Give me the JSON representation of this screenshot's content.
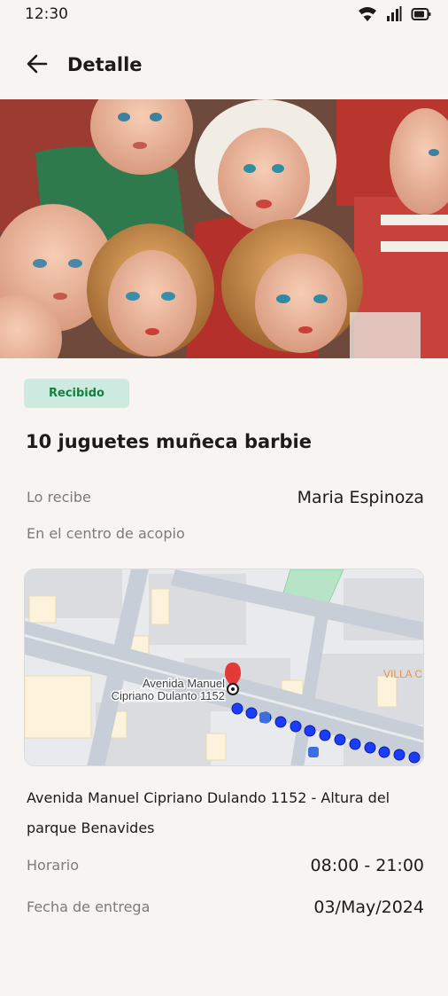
{
  "status_bar": {
    "time": "12:30",
    "icons": [
      "wifi-icon",
      "signal-icon",
      "battery-icon"
    ]
  },
  "app_bar": {
    "title": "Detalle",
    "back_icon": "arrow-left-icon"
  },
  "hero_image": {
    "subject": "vintage dolls"
  },
  "item": {
    "status_badge": "Recibido",
    "title": "10 juguetes muñeca barbie"
  },
  "details": {
    "receiver_label": "Lo recibe",
    "receiver_value": "Maria Espinoza",
    "location_note": "En el centro de acopio",
    "schedule_label": "Horario",
    "schedule_value": "08:00 - 21:00",
    "delivery_date_label": "Fecha de entrega",
    "delivery_date_value": "03/May/2024"
  },
  "map": {
    "pin_label_line1": "Avenida Manuel",
    "pin_label_line2": "Cipriano Dulanto 1152",
    "area_label": "VILLA C"
  },
  "address": {
    "text": "Avenida Manuel Cipriano Dulando 1152 - Altura del parque Benavides"
  },
  "colors": {
    "background": "#f8f4f1",
    "badge_bg": "#cdeae0",
    "badge_text": "#15803d",
    "secondary_text": "#7d7a77",
    "route_dots": "#1a3cff",
    "map_pin": "#e53935"
  }
}
